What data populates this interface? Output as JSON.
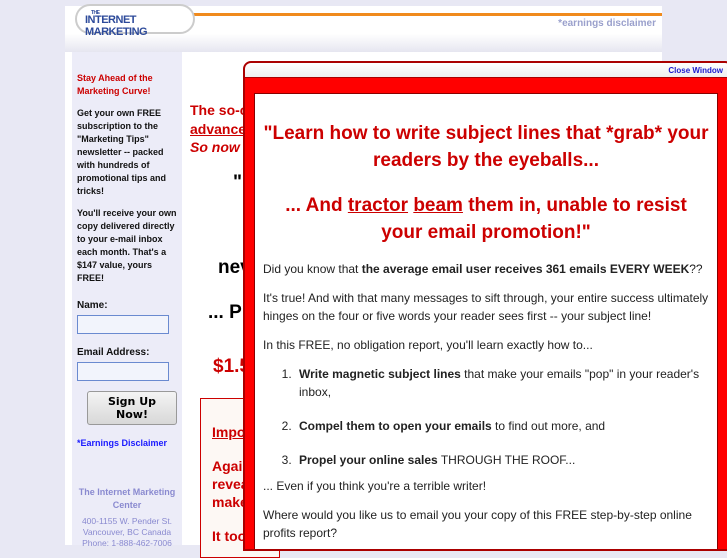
{
  "header": {
    "logo_text": "INTERNET MARKETING",
    "logo_small": "THE",
    "earnings_link": "*earnings disclaimer"
  },
  "sidebar": {
    "promo_heading": "Stay Ahead of the Marketing Curve!",
    "promo_text": "Get your own FREE subscription to the \"Marketing Tips\" newsletter -- packed with hundreds of promotional tips and tricks!",
    "promo_text2": "You'll receive your own copy delivered directly to your e-mail inbox each month. That's a $147 value, yours FREE!",
    "name_label": "Name:",
    "email_label": "Email Address:",
    "signup_button": "Sign Up Now!",
    "earnings_disclaimer": "*Earnings Disclaimer",
    "company": "The Internet Marketing Center",
    "address1": "400-1155 W. Pender St.",
    "address2": "Vancouver, BC Canada",
    "phone": "Phone: 1-888-462-7006"
  },
  "main": {
    "l1": "The so-c",
    "l2": "advance",
    "l3": "So now y",
    "l4": "\"",
    "l5": "nev",
    "l6": "... P",
    "l7": "$1.5",
    "b1": "Impo",
    "b2": "Agai",
    "b3": "revea",
    "b4": "make",
    "b5": "It too"
  },
  "popup": {
    "close": "Close Window",
    "headline1": "\"Learn how to write subject lines that *grab* your readers by the eyeballs...",
    "headline2_a": "... And ",
    "headline2_b": "tractor",
    "headline2_c": " ",
    "headline2_d": "beam",
    "headline2_e": " them in, unable to resist your email promotion!\"",
    "p1_a": "Did you know that ",
    "p1_b": "the average email user receives 361 emails EVERY WEEK",
    "p1_c": "??",
    "p2": "It's true! And with that many messages to sift through, your entire success ultimately hinges on the four or five words your reader sees first -- your subject line!",
    "p3": "In this FREE, no obligation report, you'll learn exactly how to...",
    "items": [
      {
        "bold": "Write magnetic subject lines",
        "rest": " that make your emails \"pop\" in your reader's inbox,"
      },
      {
        "bold": "Compel them to open your emails",
        "rest": " to find out more, and"
      },
      {
        "bold": "Propel your online sales",
        "rest": " THROUGH THE ROOF..."
      }
    ],
    "p4": "... Even if you think you're a terrible writer!",
    "p5": "Where would you like us to email you your copy of this FREE step-by-step online profits report?"
  }
}
